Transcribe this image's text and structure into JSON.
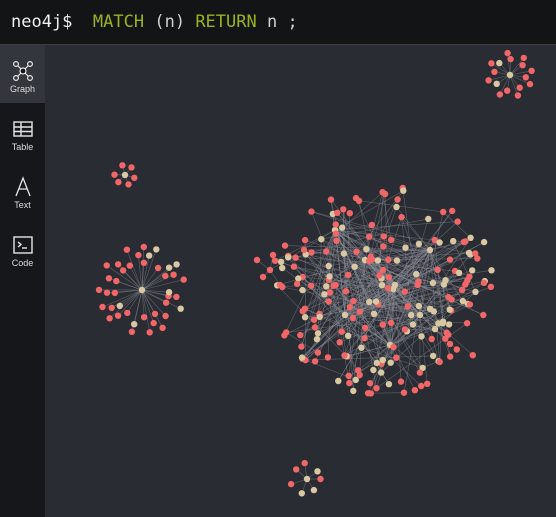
{
  "command": {
    "prompt": "neo4j$",
    "match": "MATCH",
    "pattern": "(n)",
    "return_kw": "RETURN",
    "variable": "n",
    "terminator": ";"
  },
  "sidebar": {
    "items": [
      {
        "label": "Graph",
        "icon": "graph-icon",
        "active": true
      },
      {
        "label": "Table",
        "icon": "table-icon",
        "active": false
      },
      {
        "label": "Text",
        "icon": "text-icon",
        "active": false
      },
      {
        "label": "Code",
        "icon": "code-icon",
        "active": false
      }
    ]
  },
  "colors": {
    "background": "#2a2c33",
    "node_red": "#f16667",
    "node_beige": "#d8c9a3",
    "edge": "#8a8d98",
    "keyword": "#9bb21c"
  }
}
